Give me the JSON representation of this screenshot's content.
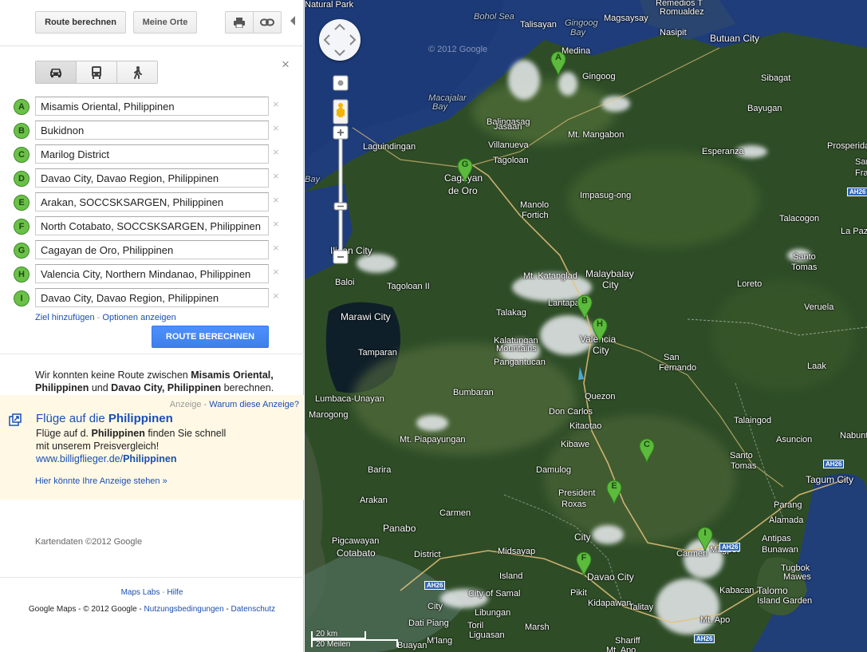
{
  "topbar": {
    "route_label": "Route berechnen",
    "places_label": "Meine Orte",
    "print_icon": "print-icon",
    "link_icon": "link-icon"
  },
  "modes": [
    {
      "name": "car-icon",
      "active": true
    },
    {
      "name": "bus-icon",
      "active": false
    },
    {
      "name": "walk-icon",
      "active": false
    }
  ],
  "close_glyph": "×",
  "waypoints": [
    {
      "letter": "A",
      "value": "Misamis Oriental, Philippinen"
    },
    {
      "letter": "B",
      "value": "Bukidnon"
    },
    {
      "letter": "C",
      "value": "Marilog District"
    },
    {
      "letter": "D",
      "value": "Davao City, Davao Region, Philippinen"
    },
    {
      "letter": "E",
      "value": "Arakan, SOCCSKSARGEN, Philippinen"
    },
    {
      "letter": "F",
      "value": "North Cotabato, SOCCSKSARGEN, Philippinen"
    },
    {
      "letter": "G",
      "value": "Cagayan de Oro, Philippinen"
    },
    {
      "letter": "H",
      "value": "Valencia City, Northern Mindanao, Philippinen"
    },
    {
      "letter": "I",
      "value": "Davao City, Davao Region, Philippinen"
    }
  ],
  "remove_glyph": "×",
  "links": {
    "add_destination": "Ziel hinzufügen",
    "separator": " - ",
    "options": "Optionen anzeigen"
  },
  "route_button": "ROUTE BERECHNEN",
  "message": {
    "part1": "Wir konnten keine Route zwischen ",
    "from": "Misamis Oriental, Philippinen",
    "part2": " und ",
    "to": "Davao City, Philippinen",
    "part3": " berechnen."
  },
  "ad": {
    "label": "Anzeige",
    "separator": " - ",
    "why": "Warum diese Anzeige?",
    "title_prefix": "Flüge auf die ",
    "title_bold": "Philippinen",
    "body_prefix": "Flüge auf d. ",
    "body_bold": "Philippinen",
    "body_suffix": " finden Sie schnell mit unserem Preisvergleich!",
    "url_prefix": "www.billigflieger.de/",
    "url_bold": "Philippinen",
    "more": "Hier könnte Ihre Anzeige stehen »"
  },
  "map_copyright": "Kartendaten ©2012 Google",
  "footer": {
    "labs": "Maps Labs",
    "sep": " - ",
    "help": "Hilfe",
    "copyright": "Google Maps - © 2012 Google - ",
    "terms": "Nutzungsbedingungen",
    "privacy": "Datenschutz"
  },
  "map": {
    "watermark": "© 2012 Google",
    "scale_km": "20 km",
    "scale_mi": "20 Meilen",
    "labels": [
      {
        "text": "Remedios T",
        "cls": ""
      },
      {
        "text": "Romualdez",
        "cls": ""
      },
      {
        "text": "Bohol Sea",
        "cls": "sea"
      },
      {
        "text": "Talisayan",
        "cls": ""
      },
      {
        "text": "Gingoog",
        "cls": "sea"
      },
      {
        "text": "Bay",
        "cls": "sea"
      },
      {
        "text": "Magsaysay",
        "cls": ""
      },
      {
        "text": "Nasipit",
        "cls": ""
      },
      {
        "text": "Butuan City",
        "cls": "big"
      },
      {
        "text": "Medina",
        "cls": ""
      },
      {
        "text": "Gingoog",
        "cls": ""
      },
      {
        "text": "Sibagat",
        "cls": ""
      },
      {
        "text": "Macajalar",
        "cls": "sea"
      },
      {
        "text": "Bay",
        "cls": "sea"
      },
      {
        "text": "Balingasag",
        "cls": ""
      },
      {
        "text": "Mt. Mangabon",
        "cls": ""
      },
      {
        "text": "Bayugan",
        "cls": ""
      },
      {
        "text": "Jasaan",
        "cls": ""
      },
      {
        "text": "Villanueva",
        "cls": ""
      },
      {
        "text": "Laguindingan",
        "cls": ""
      },
      {
        "text": "Esperanza",
        "cls": ""
      },
      {
        "text": "Prosperidad",
        "cls": ""
      },
      {
        "text": "San",
        "cls": ""
      },
      {
        "text": "Francisco",
        "cls": ""
      },
      {
        "text": "Tagoloan",
        "cls": ""
      },
      {
        "text": "Cagayan",
        "cls": "big"
      },
      {
        "text": "de Oro",
        "cls": "big"
      },
      {
        "text": "Bay",
        "cls": "sea"
      },
      {
        "text": "Impasug-ong",
        "cls": ""
      },
      {
        "text": "Manolo",
        "cls": ""
      },
      {
        "text": "Fortich",
        "cls": ""
      },
      {
        "text": "Talacogon",
        "cls": ""
      },
      {
        "text": "La Paz",
        "cls": ""
      },
      {
        "text": "Iligan City",
        "cls": "big"
      },
      {
        "text": "Santo",
        "cls": ""
      },
      {
        "text": "Tomas",
        "cls": ""
      },
      {
        "text": "Baloi",
        "cls": ""
      },
      {
        "text": "Tagoloan II",
        "cls": ""
      },
      {
        "text": "Mt. Katanglad",
        "cls": ""
      },
      {
        "text": "Malaybalay",
        "cls": "big"
      },
      {
        "text": "City",
        "cls": "big"
      },
      {
        "text": "Loreto",
        "cls": ""
      },
      {
        "text": "Lantapan",
        "cls": ""
      },
      {
        "text": "Veruela",
        "cls": ""
      },
      {
        "text": "Marawi City",
        "cls": "big"
      },
      {
        "text": "Talakag",
        "cls": ""
      },
      {
        "text": "Valencia",
        "cls": "big"
      },
      {
        "text": "City",
        "cls": "big"
      },
      {
        "text": "Kalatungan",
        "cls": ""
      },
      {
        "text": "Mountains",
        "cls": ""
      },
      {
        "text": "Tamparan",
        "cls": ""
      },
      {
        "text": "Pangantucan",
        "cls": ""
      },
      {
        "text": "San",
        "cls": ""
      },
      {
        "text": "Fernando",
        "cls": ""
      },
      {
        "text": "Laak",
        "cls": ""
      },
      {
        "text": "Quezon",
        "cls": ""
      },
      {
        "text": "Lumbaca-Unayan",
        "cls": ""
      },
      {
        "text": "Bumbaran",
        "cls": ""
      },
      {
        "text": "Marogong",
        "cls": ""
      },
      {
        "text": "Mt. Piapayungan",
        "cls": ""
      },
      {
        "text": "Don Carlos",
        "cls": ""
      },
      {
        "text": "Kitaotao",
        "cls": ""
      },
      {
        "text": "Talaingod",
        "cls": ""
      },
      {
        "text": "Asuncion",
        "cls": ""
      },
      {
        "text": "Nabunturan",
        "cls": ""
      },
      {
        "text": "Kibawe",
        "cls": ""
      },
      {
        "text": "Santo",
        "cls": ""
      },
      {
        "text": "Tomas",
        "cls": ""
      },
      {
        "text": "Barira",
        "cls": ""
      },
      {
        "text": "Damulog",
        "cls": ""
      },
      {
        "text": "Tagum City",
        "cls": "big"
      },
      {
        "text": "President",
        "cls": ""
      },
      {
        "text": "Roxas",
        "cls": ""
      },
      {
        "text": "Arakan",
        "cls": ""
      },
      {
        "text": "Parang",
        "cls": ""
      },
      {
        "text": "Carmen",
        "cls": ""
      },
      {
        "text": "Alamada",
        "cls": ""
      },
      {
        "text": "Panabo",
        "cls": "big"
      },
      {
        "text": "Pigcawayan",
        "cls": ""
      },
      {
        "text": "Cotabato",
        "cls": "big"
      },
      {
        "text": "City",
        "cls": "big"
      },
      {
        "text": "Antipas",
        "cls": ""
      },
      {
        "text": "Bunawan",
        "cls": ""
      },
      {
        "text": "District",
        "cls": ""
      },
      {
        "text": "Midsayap",
        "cls": ""
      },
      {
        "text": "Carmen",
        "cls": ""
      },
      {
        "text": "Davao City",
        "cls": "big"
      },
      {
        "text": "Magpet",
        "cls": ""
      },
      {
        "text": "Tugbok",
        "cls": ""
      },
      {
        "text": "Mawes",
        "cls": ""
      },
      {
        "text": "Island",
        "cls": ""
      },
      {
        "text": "Kabacan",
        "cls": ""
      },
      {
        "text": "Talomo",
        "cls": "big"
      },
      {
        "text": "Island Garden",
        "cls": ""
      },
      {
        "text": "City of Samal",
        "cls": ""
      },
      {
        "text": "Pikit",
        "cls": ""
      },
      {
        "text": "Kidapawan",
        "cls": ""
      },
      {
        "text": "City",
        "cls": ""
      },
      {
        "text": "Dati Piang",
        "cls": ""
      },
      {
        "text": "Libungan",
        "cls": ""
      },
      {
        "text": "Talitay",
        "cls": ""
      },
      {
        "text": "Mt. Apo",
        "cls": ""
      },
      {
        "text": "Toril",
        "cls": ""
      },
      {
        "text": "Liguasan",
        "cls": ""
      },
      {
        "text": "Marsh",
        "cls": ""
      },
      {
        "text": "M'lang",
        "cls": ""
      },
      {
        "text": "Buayan",
        "cls": ""
      },
      {
        "text": "Shariff",
        "cls": ""
      },
      {
        "text": "Mt. Apo",
        "cls": ""
      },
      {
        "text": "Natural Park",
        "cls": ""
      }
    ],
    "shields": [
      "AH26",
      "AH26",
      "AH26",
      "AH26",
      "AH26"
    ],
    "pins": [
      "A",
      "B",
      "C",
      "E",
      "F",
      "G",
      "H",
      "I"
    ]
  }
}
